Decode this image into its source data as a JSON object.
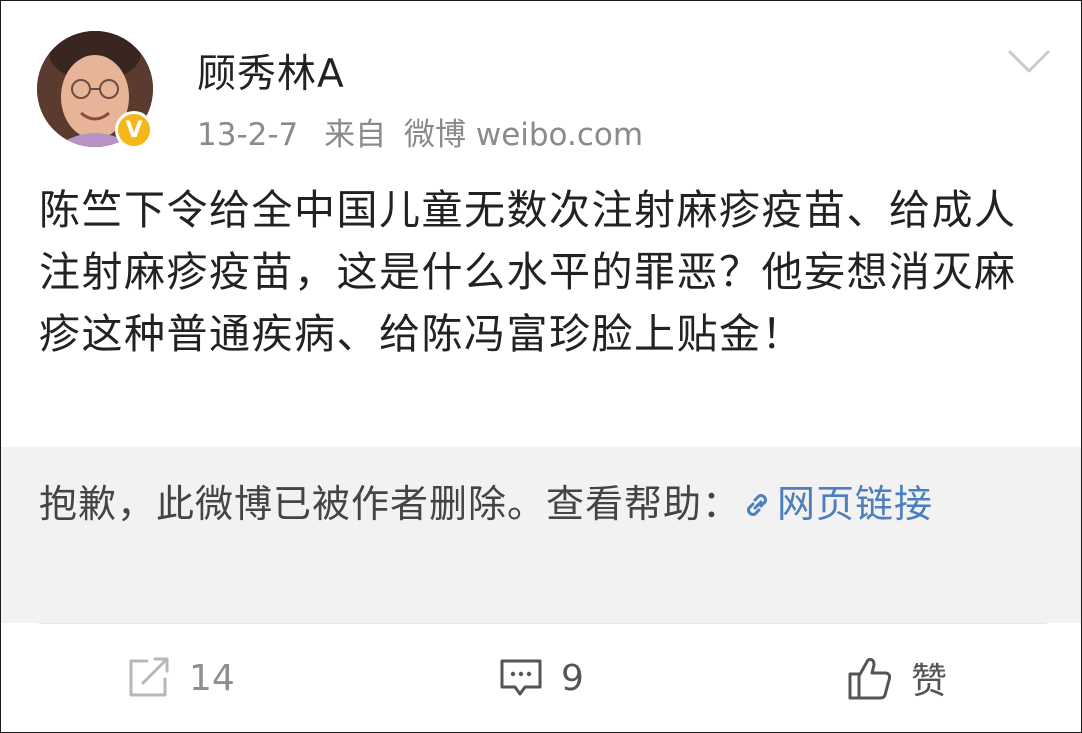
{
  "post": {
    "author": "顾秀林A",
    "verified_badge": "V",
    "date": "13-2-7",
    "source_prefix": "来自",
    "source_name": "微博 weibo.com",
    "content": "陈竺下令给全中国儿童无数次注射麻疹疫苗、给成人注射麻疹疫苗，这是什么水平的罪恶？他妄想消灭麻疹这种普通疾病、给陈冯富珍脸上贴金！"
  },
  "deleted_notice": {
    "text": "抱歉，此微博已被作者删除。查看帮助：",
    "link_label": "网页链接",
    "link_icon": "link-icon"
  },
  "actions": {
    "repost_count": "14",
    "comment_count": "9",
    "like_label": "赞"
  },
  "colors": {
    "badge": "#f5b71c",
    "link": "#4d7fbd",
    "notice_bg": "#f2f2f2",
    "meta_text": "#8a8a8a"
  }
}
